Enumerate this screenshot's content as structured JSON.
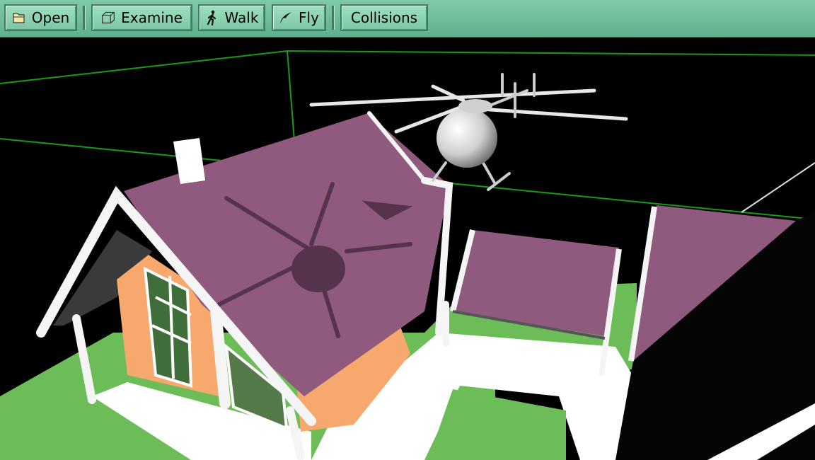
{
  "toolbar": {
    "open_label": "Open",
    "examine_label": "Examine",
    "walk_label": "Walk",
    "fly_label": "Fly",
    "collisions_label": "Collisions"
  },
  "icons": {
    "open": "folder-open-icon",
    "examine": "cube-wireframe-icon",
    "walk": "walking-person-icon",
    "fly": "bird-fly-icon"
  },
  "colors": {
    "toolbar_bg": "#7fcaa8",
    "roof": "#8f5a7d",
    "lawn": "#6cbd58",
    "walls": "#f7a86c",
    "bounding_box": "#1a9a1a"
  }
}
